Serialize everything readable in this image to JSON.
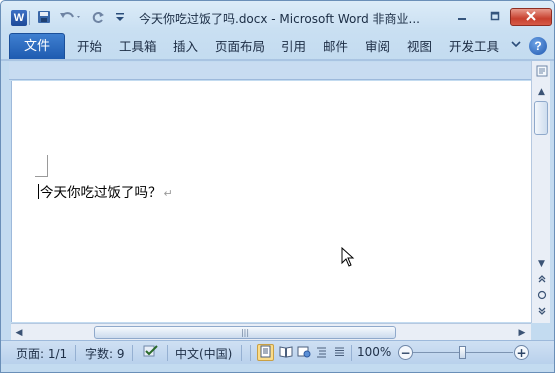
{
  "window": {
    "title": "今天你吃过饭了吗.docx  -  Microsoft Word 非商业...",
    "app_icon_letter": "W"
  },
  "qat": {
    "icons": [
      "save-icon",
      "undo-icon",
      "redo-icon",
      "customize-qat-icon"
    ]
  },
  "ribbon": {
    "file_tab": "文件",
    "tabs": [
      "开始",
      "工具箱",
      "插入",
      "页面布局",
      "引用",
      "邮件",
      "审阅",
      "视图",
      "开发工具"
    ]
  },
  "document": {
    "text": "今天你吃过饭了吗？",
    "paragraph_mark": "↵"
  },
  "statusbar": {
    "page": "页面: 1/1",
    "word_count": "字数: 9",
    "language": "中文(中国)",
    "zoom": "100%",
    "zoom_level": 1.0,
    "views": [
      "print-layout-icon",
      "full-screen-reading-icon",
      "web-layout-icon",
      "outline-icon",
      "draft-icon"
    ],
    "active_view": "print-layout-icon"
  },
  "colors": {
    "file_tab": "#1e5bb0",
    "active_view_highlight": "#fbdc89",
    "close_button": "#c8412f"
  }
}
